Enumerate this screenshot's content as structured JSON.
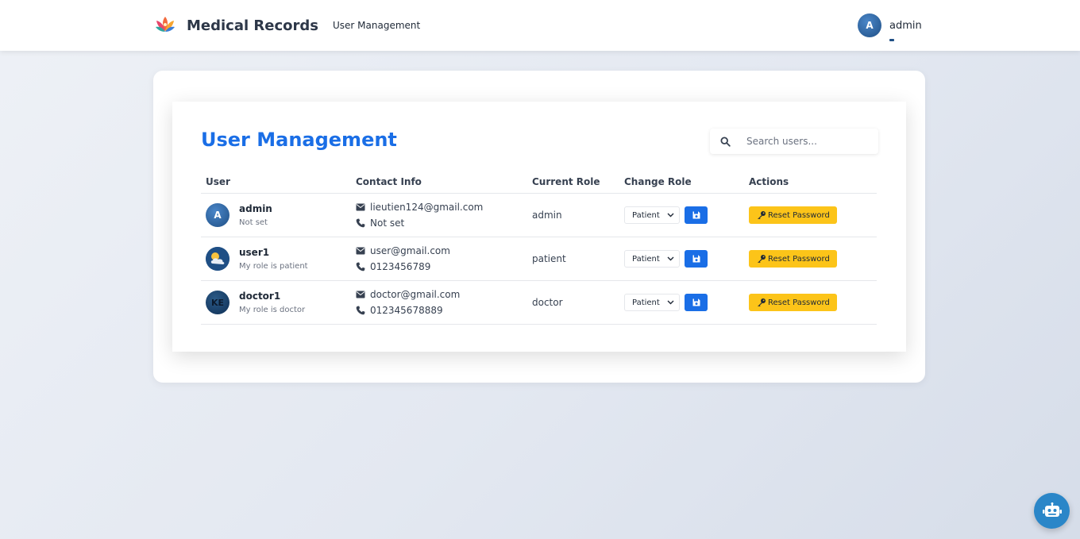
{
  "navbar": {
    "brand_name": "Medical Records",
    "nav_link": "User Management",
    "user_initial": "A",
    "username": "admin"
  },
  "page": {
    "title": "User Management",
    "search_placeholder": "Search users..."
  },
  "table": {
    "headers": [
      "User",
      "Contact Info",
      "Current Role",
      "Change Role",
      "Actions"
    ],
    "rows": [
      {
        "avatar": "A",
        "avatar_icon": "initial-avatar",
        "name": "admin",
        "subtitle": "Not set",
        "email": "lieutien124@gmail.com",
        "phone": "Not set",
        "current_role": "admin",
        "change_role": "Patient",
        "action_label": "Reset Password"
      },
      {
        "avatar": "",
        "avatar_icon": "weather-avatar",
        "name": "user1",
        "subtitle": "My role is patient",
        "email": "user@gmail.com",
        "phone": "0123456789",
        "current_role": "patient",
        "change_role": "Patient",
        "action_label": "Reset Password"
      },
      {
        "avatar": "KE",
        "avatar_icon": "image-avatar",
        "name": "doctor1",
        "subtitle": "My role is doctor",
        "email": "doctor@gmail.com",
        "phone": "012345678889",
        "current_role": "doctor",
        "change_role": "Patient",
        "action_label": "Reset Password"
      }
    ]
  },
  "colors": {
    "accent": "#1a6ee6",
    "warning": "#fcc419",
    "navy": "#1f4f85",
    "chat_fab": "#2a86c8"
  },
  "icons": {
    "brand": "lotus-logo-icon",
    "search": "search-icon",
    "email": "envelope-icon",
    "phone": "phone-icon",
    "save": "floppy-disk-icon",
    "reset": "key-icon",
    "dropdown": "chevron-down-icon",
    "chat": "robot-icon"
  }
}
